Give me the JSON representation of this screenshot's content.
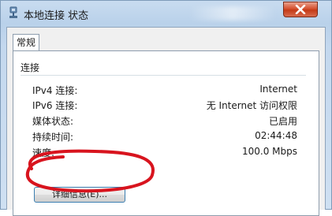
{
  "window": {
    "title": "本地连接 状态",
    "close_glyph": "✕"
  },
  "tabs": [
    {
      "label": "常规",
      "selected": true
    }
  ],
  "connection": {
    "section_label": "连接",
    "rows": [
      {
        "label": "IPv4 连接:",
        "value": "Internet"
      },
      {
        "label": "IPv6 连接:",
        "value": "无 Internet 访问权限"
      },
      {
        "label": "媒体状态:",
        "value": "已启用"
      },
      {
        "label": "持续时间:",
        "value": "02:44:48"
      },
      {
        "label": "速度:",
        "value": "100.0 Mbps"
      }
    ],
    "details_button": "详细信息(E)..."
  },
  "colors": {
    "annotation": "#d8141e",
    "close_button": "#c43a17",
    "button_border": "#3c7fb1"
  }
}
